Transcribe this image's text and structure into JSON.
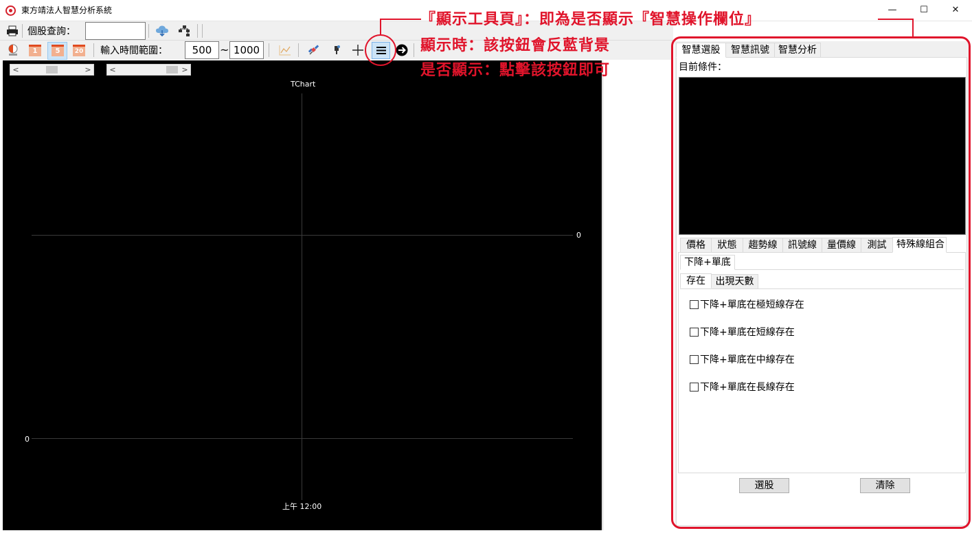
{
  "window": {
    "title": "東方靖法人智慧分析系統",
    "controls": {
      "minimize": "—",
      "maximize": "☐",
      "close": "✕"
    }
  },
  "toolbar1": {
    "stock_query_label": "個股查詢：",
    "stock_query_value": "",
    "icons": [
      "printer-icon",
      "cloud-download-icon",
      "tree-structure-icon"
    ]
  },
  "toolbar2": {
    "icons": [
      "halfday-icon",
      "day-1-icon",
      "day-5-icon",
      "day-20-icon",
      "chart-type-icon",
      "satellite-icon",
      "tool-icon",
      "crosshair-icon",
      "menu-icon",
      "go-arrow-icon"
    ],
    "day_labels": {
      "d1": "1",
      "d5": "5",
      "d20": "20"
    },
    "range_label": "輸入時間範圍：",
    "range_from": "500",
    "range_sep": "~",
    "range_to": "1000",
    "active_button": "display-toolpage-button",
    "active_color": "#cce4f7"
  },
  "chart": {
    "title": "TChart",
    "right_axis_label": "0",
    "left_axis_label": "0",
    "x_axis_label": "上午 12:00",
    "scroll_left": "<",
    "scroll_right": ">",
    "background": "#000000"
  },
  "panel": {
    "top_tabs": [
      "智慧選股",
      "智慧訊號",
      "智慧分析"
    ],
    "condition_label": "目前條件：",
    "sub_tabs": [
      "價格",
      "狀態",
      "趨勢線",
      "訊號線",
      "量價線",
      "測試",
      "特殊線組合"
    ],
    "combo_tab": "下降+單底",
    "inner_tabs": [
      "存在",
      "出現天數"
    ],
    "checkboxes": [
      "下降+單底在極短線存在",
      "下降+單底在短線存在",
      "下降+單底在中線存在",
      "下降+單底在長線存在"
    ],
    "select_button": "選股",
    "clear_button": "清除"
  },
  "annotation": {
    "line1": "『顯示工具頁』：即為是否顯示『智慧操作欄位』",
    "line2": "顯示時：該按鈕會反藍背景",
    "line3": "是否顯示：點擊該按鈕即可",
    "color": "#e0142b"
  }
}
